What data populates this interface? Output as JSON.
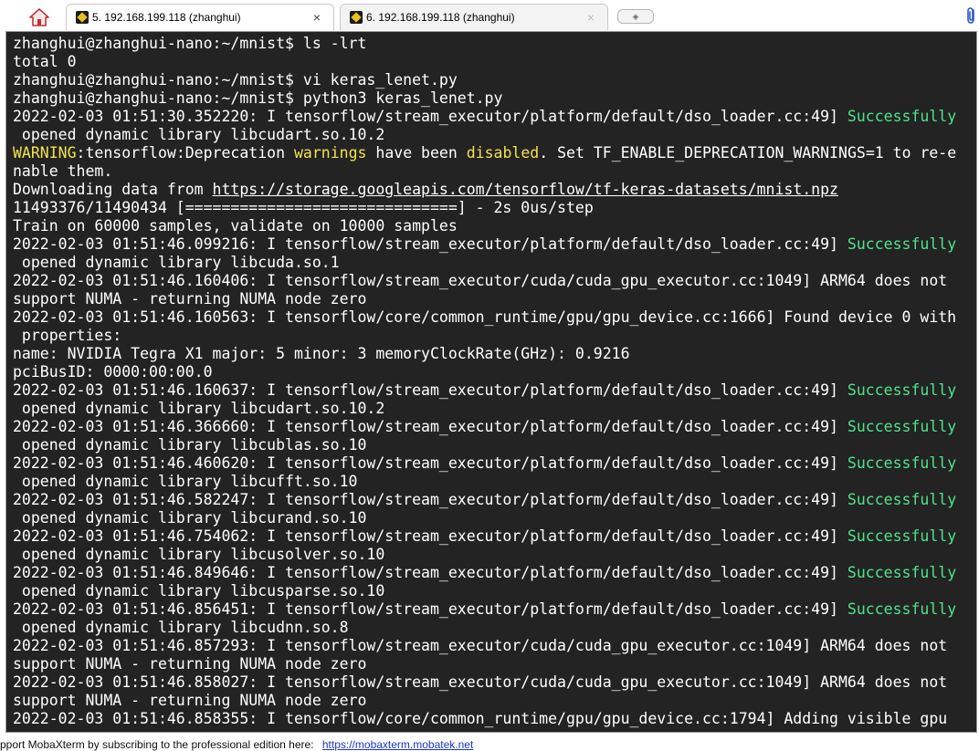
{
  "tabs": [
    {
      "title": "5. 192.168.199.118 (zhanghui)",
      "close": "×",
      "active": true
    },
    {
      "title": "6. 192.168.199.118 (zhanghui)",
      "close": "×",
      "active": false
    }
  ],
  "new_tab_label": "◈",
  "terminal": {
    "lines": [
      [
        {
          "t": "zhanghui@zhanghui-nano:~/mnist$ ls -lrt"
        }
      ],
      [
        {
          "t": "total 0"
        }
      ],
      [
        {
          "t": "zhanghui@zhanghui-nano:~/mnist$ vi keras_lenet.py"
        }
      ],
      [
        {
          "t": "zhanghui@zhanghui-nano:~/mnist$ python3 keras_lenet.py"
        }
      ],
      [
        {
          "t": "2022-02-03 01:51:30.352220: I tensorflow/stream_executor/platform/default/dso_loader.cc:49] "
        },
        {
          "t": "Successfully",
          "c": "green"
        }
      ],
      [
        {
          "t": " opened dynamic library libcudart.so.10.2"
        }
      ],
      [
        {
          "t": "WARNING",
          "c": "yellow"
        },
        {
          "t": ":tensorflow:Deprecation "
        },
        {
          "t": "warnings",
          "c": "yellow"
        },
        {
          "t": " have been "
        },
        {
          "t": "disabled",
          "c": "yellow"
        },
        {
          "t": ". Set TF_ENABLE_DEPRECATION_WARNINGS=1 to re-e"
        }
      ],
      [
        {
          "t": "nable them."
        }
      ],
      [
        {
          "t": "Downloading data from "
        },
        {
          "t": "https://storage.googleapis.com/tensorflow/tf-keras-datasets/mnist.npz",
          "c": "link"
        }
      ],
      [
        {
          "t": "11493376/11490434 [==============================] - 2s 0us/step"
        }
      ],
      [
        {
          "t": "Train on 60000 samples, validate on 10000 samples"
        }
      ],
      [
        {
          "t": "2022-02-03 01:51:46.099216: I tensorflow/stream_executor/platform/default/dso_loader.cc:49] "
        },
        {
          "t": "Successfully",
          "c": "green"
        }
      ],
      [
        {
          "t": " opened dynamic library libcuda.so.1"
        }
      ],
      [
        {
          "t": "2022-02-03 01:51:46.160406: I tensorflow/stream_executor/cuda/cuda_gpu_executor.cc:1049] ARM64 does not"
        }
      ],
      [
        {
          "t": "support NUMA - returning NUMA node zero"
        }
      ],
      [
        {
          "t": "2022-02-03 01:51:46.160563: I tensorflow/core/common_runtime/gpu/gpu_device.cc:1666] Found device 0 with"
        }
      ],
      [
        {
          "t": " properties:"
        }
      ],
      [
        {
          "t": "name: NVIDIA Tegra X1 major: 5 minor: 3 memoryClockRate(GHz): 0.9216"
        }
      ],
      [
        {
          "t": "pciBusID: 0000:00:00.0"
        }
      ],
      [
        {
          "t": "2022-02-03 01:51:46.160637: I tensorflow/stream_executor/platform/default/dso_loader.cc:49] "
        },
        {
          "t": "Successfully",
          "c": "green"
        }
      ],
      [
        {
          "t": " opened dynamic library libcudart.so.10.2"
        }
      ],
      [
        {
          "t": "2022-02-03 01:51:46.366660: I tensorflow/stream_executor/platform/default/dso_loader.cc:49] "
        },
        {
          "t": "Successfully",
          "c": "green"
        }
      ],
      [
        {
          "t": " opened dynamic library libcublas.so.10"
        }
      ],
      [
        {
          "t": "2022-02-03 01:51:46.460620: I tensorflow/stream_executor/platform/default/dso_loader.cc:49] "
        },
        {
          "t": "Successfully",
          "c": "green"
        }
      ],
      [
        {
          "t": " opened dynamic library libcufft.so.10"
        }
      ],
      [
        {
          "t": "2022-02-03 01:51:46.582247: I tensorflow/stream_executor/platform/default/dso_loader.cc:49] "
        },
        {
          "t": "Successfully",
          "c": "green"
        }
      ],
      [
        {
          "t": " opened dynamic library libcurand.so.10"
        }
      ],
      [
        {
          "t": "2022-02-03 01:51:46.754062: I tensorflow/stream_executor/platform/default/dso_loader.cc:49] "
        },
        {
          "t": "Successfully",
          "c": "green"
        }
      ],
      [
        {
          "t": " opened dynamic library libcusolver.so.10"
        }
      ],
      [
        {
          "t": "2022-02-03 01:51:46.849646: I tensorflow/stream_executor/platform/default/dso_loader.cc:49] "
        },
        {
          "t": "Successfully",
          "c": "green"
        }
      ],
      [
        {
          "t": " opened dynamic library libcusparse.so.10"
        }
      ],
      [
        {
          "t": "2022-02-03 01:51:46.856451: I tensorflow/stream_executor/platform/default/dso_loader.cc:49] "
        },
        {
          "t": "Successfully",
          "c": "green"
        }
      ],
      [
        {
          "t": " opened dynamic library libcudnn.so.8"
        }
      ],
      [
        {
          "t": "2022-02-03 01:51:46.857293: I tensorflow/stream_executor/cuda/cuda_gpu_executor.cc:1049] ARM64 does not"
        }
      ],
      [
        {
          "t": "support NUMA - returning NUMA node zero"
        }
      ],
      [
        {
          "t": "2022-02-03 01:51:46.858027: I tensorflow/stream_executor/cuda/cuda_gpu_executor.cc:1049] ARM64 does not"
        }
      ],
      [
        {
          "t": "support NUMA - returning NUMA node zero"
        }
      ],
      [
        {
          "t": "2022-02-03 01:51:46.858355: I tensorflow/core/common_runtime/gpu/gpu_device.cc:1794] Adding visible gpu"
        }
      ]
    ]
  },
  "status_bar": {
    "text": "pport MobaXterm by subscribing to the professional edition here:",
    "link": "https://mobaxterm.mobatek.net"
  },
  "colors": {
    "terminal_bg": "#232323",
    "terminal_fg": "#ffffff",
    "success_green": "#4ee38a",
    "warning_yellow": "#f2e24c",
    "link_blue": "#1a35c8"
  },
  "icons": {
    "home": "home-icon",
    "tab": "terminal-session-icon",
    "attach": "paperclip-icon"
  }
}
